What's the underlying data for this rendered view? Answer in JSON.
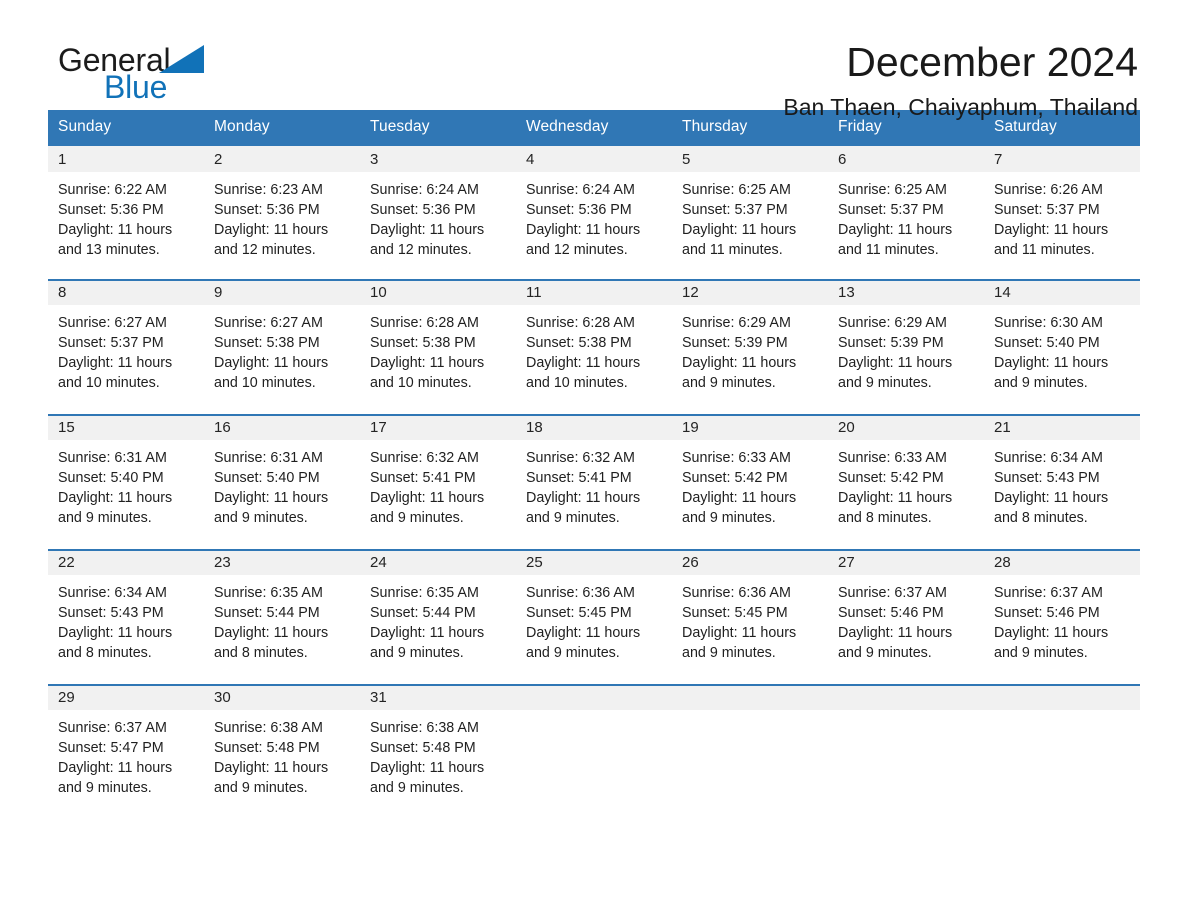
{
  "brand": {
    "name_part1": "General",
    "name_part2": "Blue",
    "logo_icon": "triangle-flag-icon",
    "accent_color": "#1172b8"
  },
  "header": {
    "month_title": "December 2024",
    "location": "Ban Thaen, Chaiyaphum, Thailand"
  },
  "theme": {
    "header_blue": "#3077b5",
    "daynum_band": "#f1f1f1",
    "page_background": "#ffffff",
    "text_color": "#1f1f1f"
  },
  "calendar": {
    "weekday_headers": [
      "Sunday",
      "Monday",
      "Tuesday",
      "Wednesday",
      "Thursday",
      "Friday",
      "Saturday"
    ],
    "weeks": [
      [
        {
          "day": "1",
          "sunrise": "Sunrise: 6:22 AM",
          "sunset": "Sunset: 5:36 PM",
          "daylight_line1": "Daylight: 11 hours",
          "daylight_line2": "and 13 minutes."
        },
        {
          "day": "2",
          "sunrise": "Sunrise: 6:23 AM",
          "sunset": "Sunset: 5:36 PM",
          "daylight_line1": "Daylight: 11 hours",
          "daylight_line2": "and 12 minutes."
        },
        {
          "day": "3",
          "sunrise": "Sunrise: 6:24 AM",
          "sunset": "Sunset: 5:36 PM",
          "daylight_line1": "Daylight: 11 hours",
          "daylight_line2": "and 12 minutes."
        },
        {
          "day": "4",
          "sunrise": "Sunrise: 6:24 AM",
          "sunset": "Sunset: 5:36 PM",
          "daylight_line1": "Daylight: 11 hours",
          "daylight_line2": "and 12 minutes."
        },
        {
          "day": "5",
          "sunrise": "Sunrise: 6:25 AM",
          "sunset": "Sunset: 5:37 PM",
          "daylight_line1": "Daylight: 11 hours",
          "daylight_line2": "and 11 minutes."
        },
        {
          "day": "6",
          "sunrise": "Sunrise: 6:25 AM",
          "sunset": "Sunset: 5:37 PM",
          "daylight_line1": "Daylight: 11 hours",
          "daylight_line2": "and 11 minutes."
        },
        {
          "day": "7",
          "sunrise": "Sunrise: 6:26 AM",
          "sunset": "Sunset: 5:37 PM",
          "daylight_line1": "Daylight: 11 hours",
          "daylight_line2": "and 11 minutes."
        }
      ],
      [
        {
          "day": "8",
          "sunrise": "Sunrise: 6:27 AM",
          "sunset": "Sunset: 5:37 PM",
          "daylight_line1": "Daylight: 11 hours",
          "daylight_line2": "and 10 minutes."
        },
        {
          "day": "9",
          "sunrise": "Sunrise: 6:27 AM",
          "sunset": "Sunset: 5:38 PM",
          "daylight_line1": "Daylight: 11 hours",
          "daylight_line2": "and 10 minutes."
        },
        {
          "day": "10",
          "sunrise": "Sunrise: 6:28 AM",
          "sunset": "Sunset: 5:38 PM",
          "daylight_line1": "Daylight: 11 hours",
          "daylight_line2": "and 10 minutes."
        },
        {
          "day": "11",
          "sunrise": "Sunrise: 6:28 AM",
          "sunset": "Sunset: 5:38 PM",
          "daylight_line1": "Daylight: 11 hours",
          "daylight_line2": "and 10 minutes."
        },
        {
          "day": "12",
          "sunrise": "Sunrise: 6:29 AM",
          "sunset": "Sunset: 5:39 PM",
          "daylight_line1": "Daylight: 11 hours",
          "daylight_line2": "and 9 minutes."
        },
        {
          "day": "13",
          "sunrise": "Sunrise: 6:29 AM",
          "sunset": "Sunset: 5:39 PM",
          "daylight_line1": "Daylight: 11 hours",
          "daylight_line2": "and 9 minutes."
        },
        {
          "day": "14",
          "sunrise": "Sunrise: 6:30 AM",
          "sunset": "Sunset: 5:40 PM",
          "daylight_line1": "Daylight: 11 hours",
          "daylight_line2": "and 9 minutes."
        }
      ],
      [
        {
          "day": "15",
          "sunrise": "Sunrise: 6:31 AM",
          "sunset": "Sunset: 5:40 PM",
          "daylight_line1": "Daylight: 11 hours",
          "daylight_line2": "and 9 minutes."
        },
        {
          "day": "16",
          "sunrise": "Sunrise: 6:31 AM",
          "sunset": "Sunset: 5:40 PM",
          "daylight_line1": "Daylight: 11 hours",
          "daylight_line2": "and 9 minutes."
        },
        {
          "day": "17",
          "sunrise": "Sunrise: 6:32 AM",
          "sunset": "Sunset: 5:41 PM",
          "daylight_line1": "Daylight: 11 hours",
          "daylight_line2": "and 9 minutes."
        },
        {
          "day": "18",
          "sunrise": "Sunrise: 6:32 AM",
          "sunset": "Sunset: 5:41 PM",
          "daylight_line1": "Daylight: 11 hours",
          "daylight_line2": "and 9 minutes."
        },
        {
          "day": "19",
          "sunrise": "Sunrise: 6:33 AM",
          "sunset": "Sunset: 5:42 PM",
          "daylight_line1": "Daylight: 11 hours",
          "daylight_line2": "and 9 minutes."
        },
        {
          "day": "20",
          "sunrise": "Sunrise: 6:33 AM",
          "sunset": "Sunset: 5:42 PM",
          "daylight_line1": "Daylight: 11 hours",
          "daylight_line2": "and 8 minutes."
        },
        {
          "day": "21",
          "sunrise": "Sunrise: 6:34 AM",
          "sunset": "Sunset: 5:43 PM",
          "daylight_line1": "Daylight: 11 hours",
          "daylight_line2": "and 8 minutes."
        }
      ],
      [
        {
          "day": "22",
          "sunrise": "Sunrise: 6:34 AM",
          "sunset": "Sunset: 5:43 PM",
          "daylight_line1": "Daylight: 11 hours",
          "daylight_line2": "and 8 minutes."
        },
        {
          "day": "23",
          "sunrise": "Sunrise: 6:35 AM",
          "sunset": "Sunset: 5:44 PM",
          "daylight_line1": "Daylight: 11 hours",
          "daylight_line2": "and 8 minutes."
        },
        {
          "day": "24",
          "sunrise": "Sunrise: 6:35 AM",
          "sunset": "Sunset: 5:44 PM",
          "daylight_line1": "Daylight: 11 hours",
          "daylight_line2": "and 9 minutes."
        },
        {
          "day": "25",
          "sunrise": "Sunrise: 6:36 AM",
          "sunset": "Sunset: 5:45 PM",
          "daylight_line1": "Daylight: 11 hours",
          "daylight_line2": "and 9 minutes."
        },
        {
          "day": "26",
          "sunrise": "Sunrise: 6:36 AM",
          "sunset": "Sunset: 5:45 PM",
          "daylight_line1": "Daylight: 11 hours",
          "daylight_line2": "and 9 minutes."
        },
        {
          "day": "27",
          "sunrise": "Sunrise: 6:37 AM",
          "sunset": "Sunset: 5:46 PM",
          "daylight_line1": "Daylight: 11 hours",
          "daylight_line2": "and 9 minutes."
        },
        {
          "day": "28",
          "sunrise": "Sunrise: 6:37 AM",
          "sunset": "Sunset: 5:46 PM",
          "daylight_line1": "Daylight: 11 hours",
          "daylight_line2": "and 9 minutes."
        }
      ],
      [
        {
          "day": "29",
          "sunrise": "Sunrise: 6:37 AM",
          "sunset": "Sunset: 5:47 PM",
          "daylight_line1": "Daylight: 11 hours",
          "daylight_line2": "and 9 minutes."
        },
        {
          "day": "30",
          "sunrise": "Sunrise: 6:38 AM",
          "sunset": "Sunset: 5:48 PM",
          "daylight_line1": "Daylight: 11 hours",
          "daylight_line2": "and 9 minutes."
        },
        {
          "day": "31",
          "sunrise": "Sunrise: 6:38 AM",
          "sunset": "Sunset: 5:48 PM",
          "daylight_line1": "Daylight: 11 hours",
          "daylight_line2": "and 9 minutes."
        },
        {
          "day": "",
          "sunrise": "",
          "sunset": "",
          "daylight_line1": "",
          "daylight_line2": ""
        },
        {
          "day": "",
          "sunrise": "",
          "sunset": "",
          "daylight_line1": "",
          "daylight_line2": ""
        },
        {
          "day": "",
          "sunrise": "",
          "sunset": "",
          "daylight_line1": "",
          "daylight_line2": ""
        },
        {
          "day": "",
          "sunrise": "",
          "sunset": "",
          "daylight_line1": "",
          "daylight_line2": ""
        }
      ]
    ]
  }
}
